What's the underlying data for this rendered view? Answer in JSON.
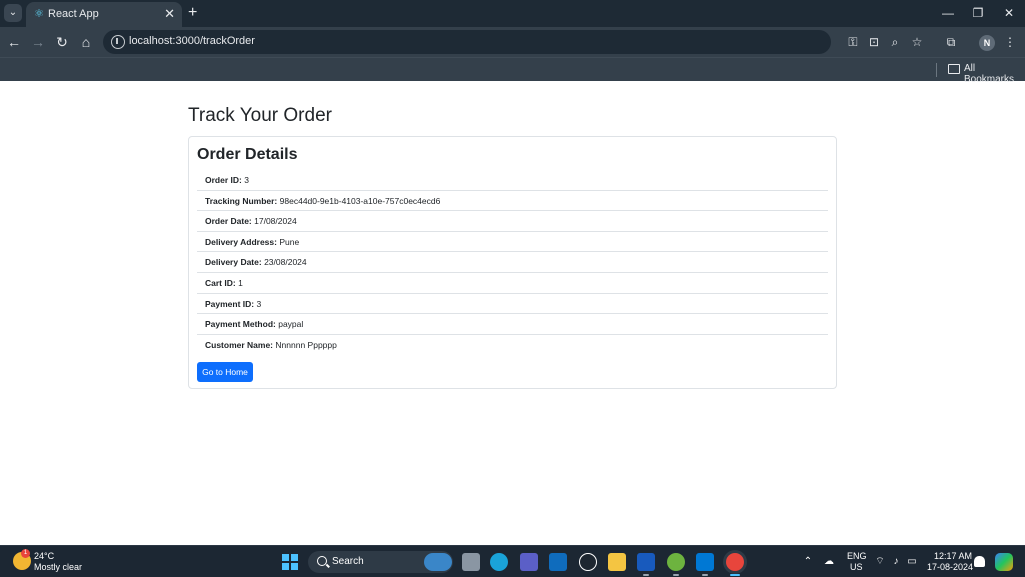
{
  "browser": {
    "tab_title": "React App",
    "url": "localhost:3000/trackOrder",
    "profile_initial": "N",
    "bookmarks_label": "All Bookmarks"
  },
  "page": {
    "title": "Track Your Order",
    "card_title": "Order Details",
    "details": [
      {
        "label": "Order ID:",
        "value": "3"
      },
      {
        "label": "Tracking Number:",
        "value": "98ec44d0-9e1b-4103-a10e-757c0ec4ecd6"
      },
      {
        "label": "Order Date:",
        "value": "17/08/2024"
      },
      {
        "label": "Delivery Address:",
        "value": "Pune"
      },
      {
        "label": "Delivery Date:",
        "value": "23/08/2024"
      },
      {
        "label": "Cart ID:",
        "value": "1"
      },
      {
        "label": "Payment ID:",
        "value": "3"
      },
      {
        "label": "Payment Method:",
        "value": "paypal"
      },
      {
        "label": "Customer Name:",
        "value": "Nnnnnn Pppppp"
      }
    ],
    "home_button": "Go to Home"
  },
  "taskbar": {
    "weather_temp": "24°C",
    "weather_desc": "Mostly clear",
    "weather_badge": "1",
    "search_label": "Search",
    "lang_line1": "ENG",
    "lang_line2": "US",
    "time": "12:17 AM",
    "date": "17-08-2024"
  },
  "colors": {
    "primary_button": "#0d6efd",
    "browser_frame": "#34404b",
    "taskbar": "#1c2733"
  }
}
